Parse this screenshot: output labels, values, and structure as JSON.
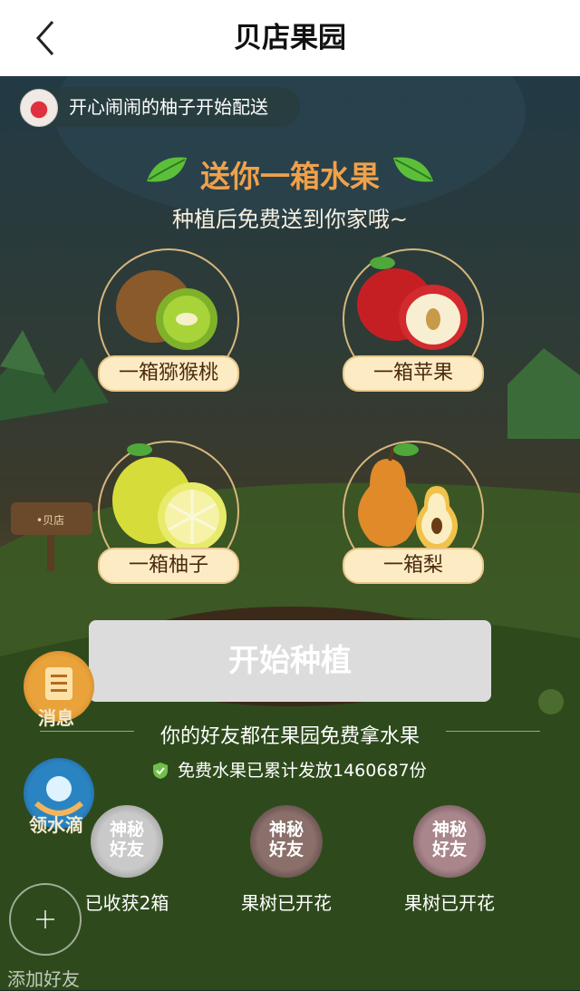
{
  "header": {
    "title": "贝店果园",
    "back_icon": "chevron-left-icon"
  },
  "notice": {
    "text": "开心闹闹的柚子开始配送"
  },
  "promo": {
    "headline": "送你一箱水果",
    "subline": "种植后免费送到你家哦~"
  },
  "fruits": [
    {
      "label": "一箱猕猴桃",
      "icon": "kiwi-icon"
    },
    {
      "label": "一箱苹果",
      "icon": "apple-icon"
    },
    {
      "label": "一箱柚子",
      "icon": "pomelo-icon"
    },
    {
      "label": "一箱梨",
      "icon": "pear-icon"
    }
  ],
  "start_button": {
    "label": "开始种植"
  },
  "side": {
    "messages_label": "消息",
    "water_label": "领水滴"
  },
  "friends": {
    "title": "你的好友都在果园免费拿水果",
    "stat": "免费水果已累计发放1460687份",
    "items": [
      {
        "avatar_text": "神秘\n好友",
        "line1": "神秘",
        "line2": "好友",
        "status": "已收获2箱"
      },
      {
        "line1": "神秘",
        "line2": "好友",
        "status": "果树已开花"
      },
      {
        "line1": "神秘",
        "line2": "好友",
        "status": "果树已开花"
      }
    ],
    "add_label": "添加好友"
  },
  "colors": {
    "accent": "#f0a14a",
    "badge_bg": "#fcebc3",
    "button_disabled": "#dcdcdc"
  }
}
